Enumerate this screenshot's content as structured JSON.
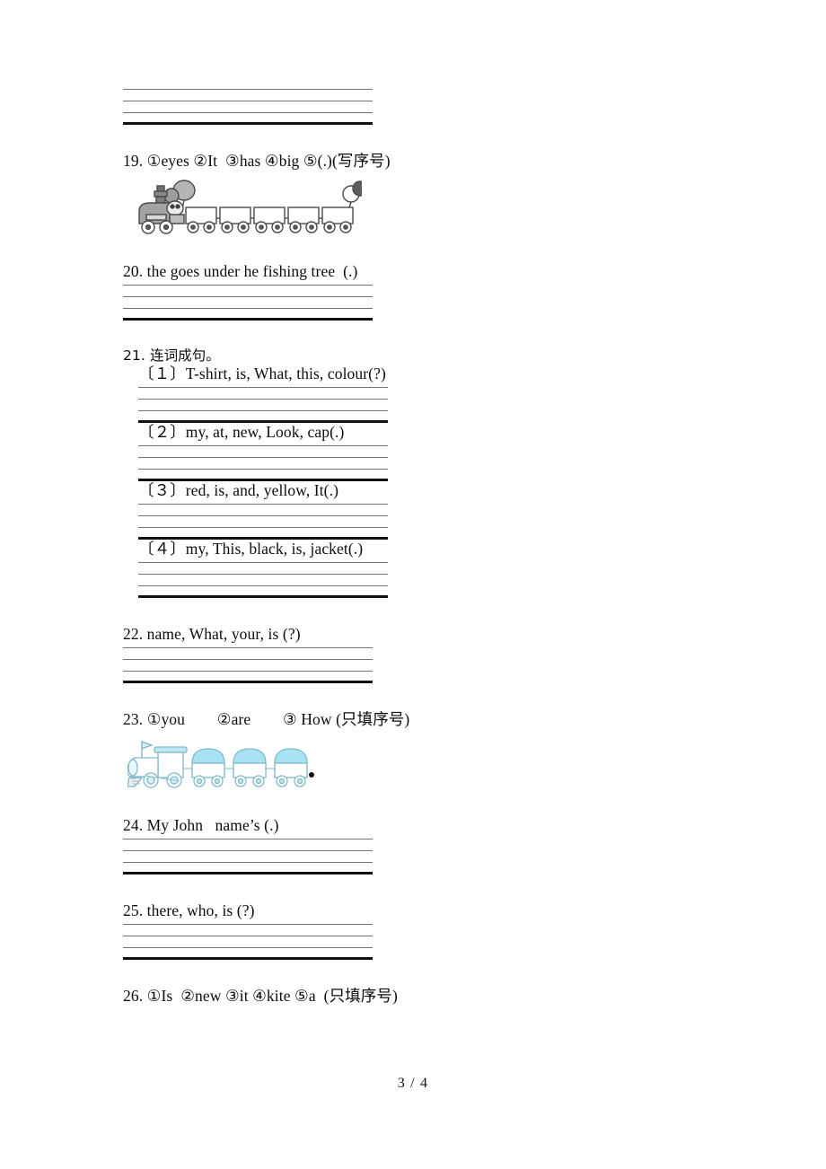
{
  "document": {
    "type": "worksheet-page",
    "footer": "3 / 4"
  },
  "top_answer_lines": {
    "label": "answer-lines-for-previous-question",
    "line_count": 4
  },
  "questions": [
    {
      "id": "q19",
      "number": "19.",
      "text": "19. ①eyes ②It  ③has ④big ⑤(.)(写序号)",
      "has_image": true,
      "image": "gray-train-five-cars",
      "answer_lines": 0
    },
    {
      "id": "q20",
      "number": "20.",
      "text": "20. the goes under he fishing tree  (.)",
      "has_image": false,
      "answer_lines": 4
    },
    {
      "id": "q21",
      "number": "21.",
      "text": "21. 连词成句。",
      "has_image": false,
      "subitems": [
        {
          "id": "q21-1",
          "text": "〔１〕T-shirt, is, What, this, colour(?)",
          "answer_lines": 4
        },
        {
          "id": "q21-2",
          "text": "〔２〕my, at, new, Look, cap(.)",
          "answer_lines": 4
        },
        {
          "id": "q21-3",
          "text": "〔３〕red, is, and, yellow, It(.)",
          "answer_lines": 4
        },
        {
          "id": "q21-4",
          "text": "〔４〕my, This, black, is, jacket(.)",
          "answer_lines": 4
        }
      ]
    },
    {
      "id": "q22",
      "number": "22.",
      "text": "22. name, What, your, is (?)",
      "has_image": false,
      "answer_lines": 4
    },
    {
      "id": "q23",
      "number": "23.",
      "text": "23. ①you        ②are        ③ How (只填序号)",
      "has_image": true,
      "image": "blue-train-three-cars",
      "answer_lines": 0
    },
    {
      "id": "q24",
      "number": "24.",
      "text": "24. My John   name’s (.)",
      "has_image": false,
      "answer_lines": 4
    },
    {
      "id": "q25",
      "number": "25.",
      "text": "25. there, who, is (?)",
      "has_image": false,
      "answer_lines": 4
    },
    {
      "id": "q26",
      "number": "26.",
      "text": "26. ①Is  ②new ③it ④kite ⑤a  (只填序号)",
      "has_image": false,
      "answer_lines": 0
    }
  ],
  "colors": {
    "text": "#0c0c0c",
    "rule_thin": "#6d6d70",
    "rule_thick": "#111111",
    "train_blue": "#a9e2f2",
    "train_blue_line": "#7fb9cc",
    "train_gray": "#8b8b8b",
    "train_gray_dark": "#4a4a4a",
    "page_bg": "#ffffff"
  }
}
